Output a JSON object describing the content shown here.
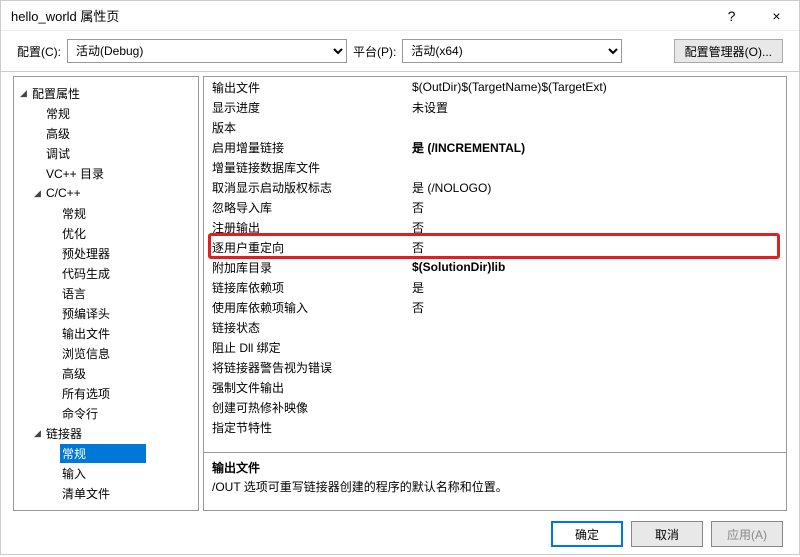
{
  "title": "hello_world 属性页",
  "help_icon": "?",
  "close_icon": "×",
  "config_label": "配置(C):",
  "config_value": "活动(Debug)",
  "platform_label": "平台(P):",
  "platform_value": "活动(x64)",
  "config_mgr": "配置管理器(O)...",
  "tree": {
    "root": "配置属性",
    "items_l1_a": [
      "常规",
      "高级",
      "调试",
      "VC++ 目录"
    ],
    "ccpp": "C/C++",
    "ccpp_items": [
      "常规",
      "优化",
      "预处理器",
      "代码生成",
      "语言",
      "预编译头",
      "输出文件",
      "浏览信息",
      "高级",
      "所有选项",
      "命令行"
    ],
    "linker": "链接器",
    "linker_items": [
      "常规",
      "输入",
      "清单文件"
    ]
  },
  "props": [
    {
      "k": "输出文件",
      "v": "$(OutDir)$(TargetName)$(TargetExt)"
    },
    {
      "k": "显示进度",
      "v": "未设置"
    },
    {
      "k": "版本",
      "v": ""
    },
    {
      "k": "启用增量链接",
      "v": "是 (/INCREMENTAL)",
      "bold": true
    },
    {
      "k": "增量链接数据库文件",
      "v": ""
    },
    {
      "k": "取消显示启动版权标志",
      "v": "是 (/NOLOGO)"
    },
    {
      "k": "忽略导入库",
      "v": "否"
    },
    {
      "k": "注册输出",
      "v": "否"
    },
    {
      "k": "逐用户重定向",
      "v": "否"
    },
    {
      "k": "附加库目录",
      "v": "$(SolutionDir)lib",
      "bold": true
    },
    {
      "k": "链接库依赖项",
      "v": "是"
    },
    {
      "k": "使用库依赖项输入",
      "v": "否"
    },
    {
      "k": "链接状态",
      "v": ""
    },
    {
      "k": "阻止 Dll 绑定",
      "v": ""
    },
    {
      "k": "将链接器警告视为错误",
      "v": ""
    },
    {
      "k": "强制文件输出",
      "v": ""
    },
    {
      "k": "创建可热修补映像",
      "v": ""
    },
    {
      "k": "指定节特性",
      "v": ""
    }
  ],
  "desc": {
    "title": "输出文件",
    "text": "/OUT 选项可重写链接器创建的程序的默认名称和位置。"
  },
  "buttons": {
    "ok": "确定",
    "cancel": "取消",
    "apply": "应用(A)"
  }
}
